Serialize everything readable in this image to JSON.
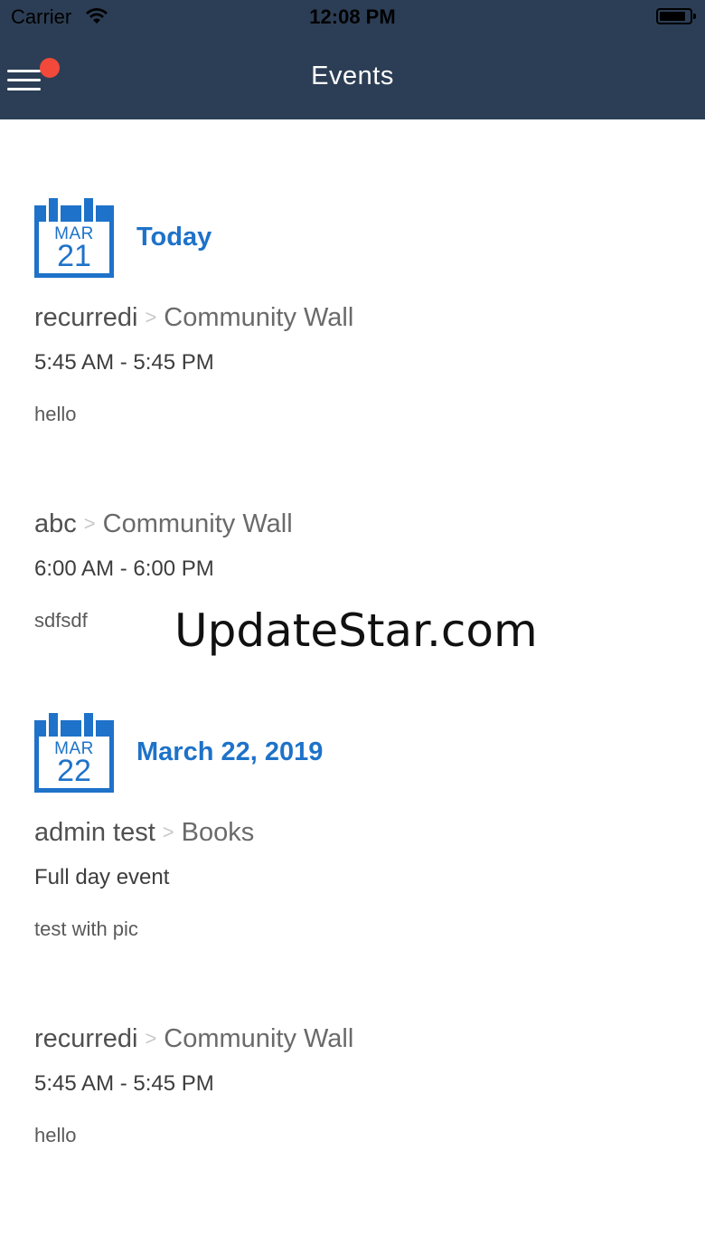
{
  "status_bar": {
    "carrier": "Carrier",
    "time": "12:08 PM"
  },
  "nav": {
    "title": "Events",
    "notification": true
  },
  "sections": [
    {
      "month": "MAR",
      "day": "21",
      "label": "Today",
      "events": [
        {
          "name": "recurredi",
          "group": "Community Wall",
          "time": "5:45 AM - 5:45 PM",
          "description": "hello"
        },
        {
          "name": "abc",
          "group": "Community Wall",
          "time": "6:00 AM - 6:00 PM",
          "description": "sdfsdf"
        }
      ]
    },
    {
      "month": "MAR",
      "day": "22",
      "label": "March 22, 2019",
      "events": [
        {
          "name": "admin test",
          "group": "Books",
          "time": "Full day event",
          "description": "test with pic"
        },
        {
          "name": "recurredi",
          "group": "Community Wall",
          "time": "5:45 AM - 5:45 PM",
          "description": "hello"
        }
      ]
    }
  ],
  "separator": ">",
  "watermark": "UpdateStar.com",
  "colors": {
    "nav_background": "#2c3e55",
    "accent_blue": "#1e72c9",
    "notification_dot": "#f2493b"
  }
}
